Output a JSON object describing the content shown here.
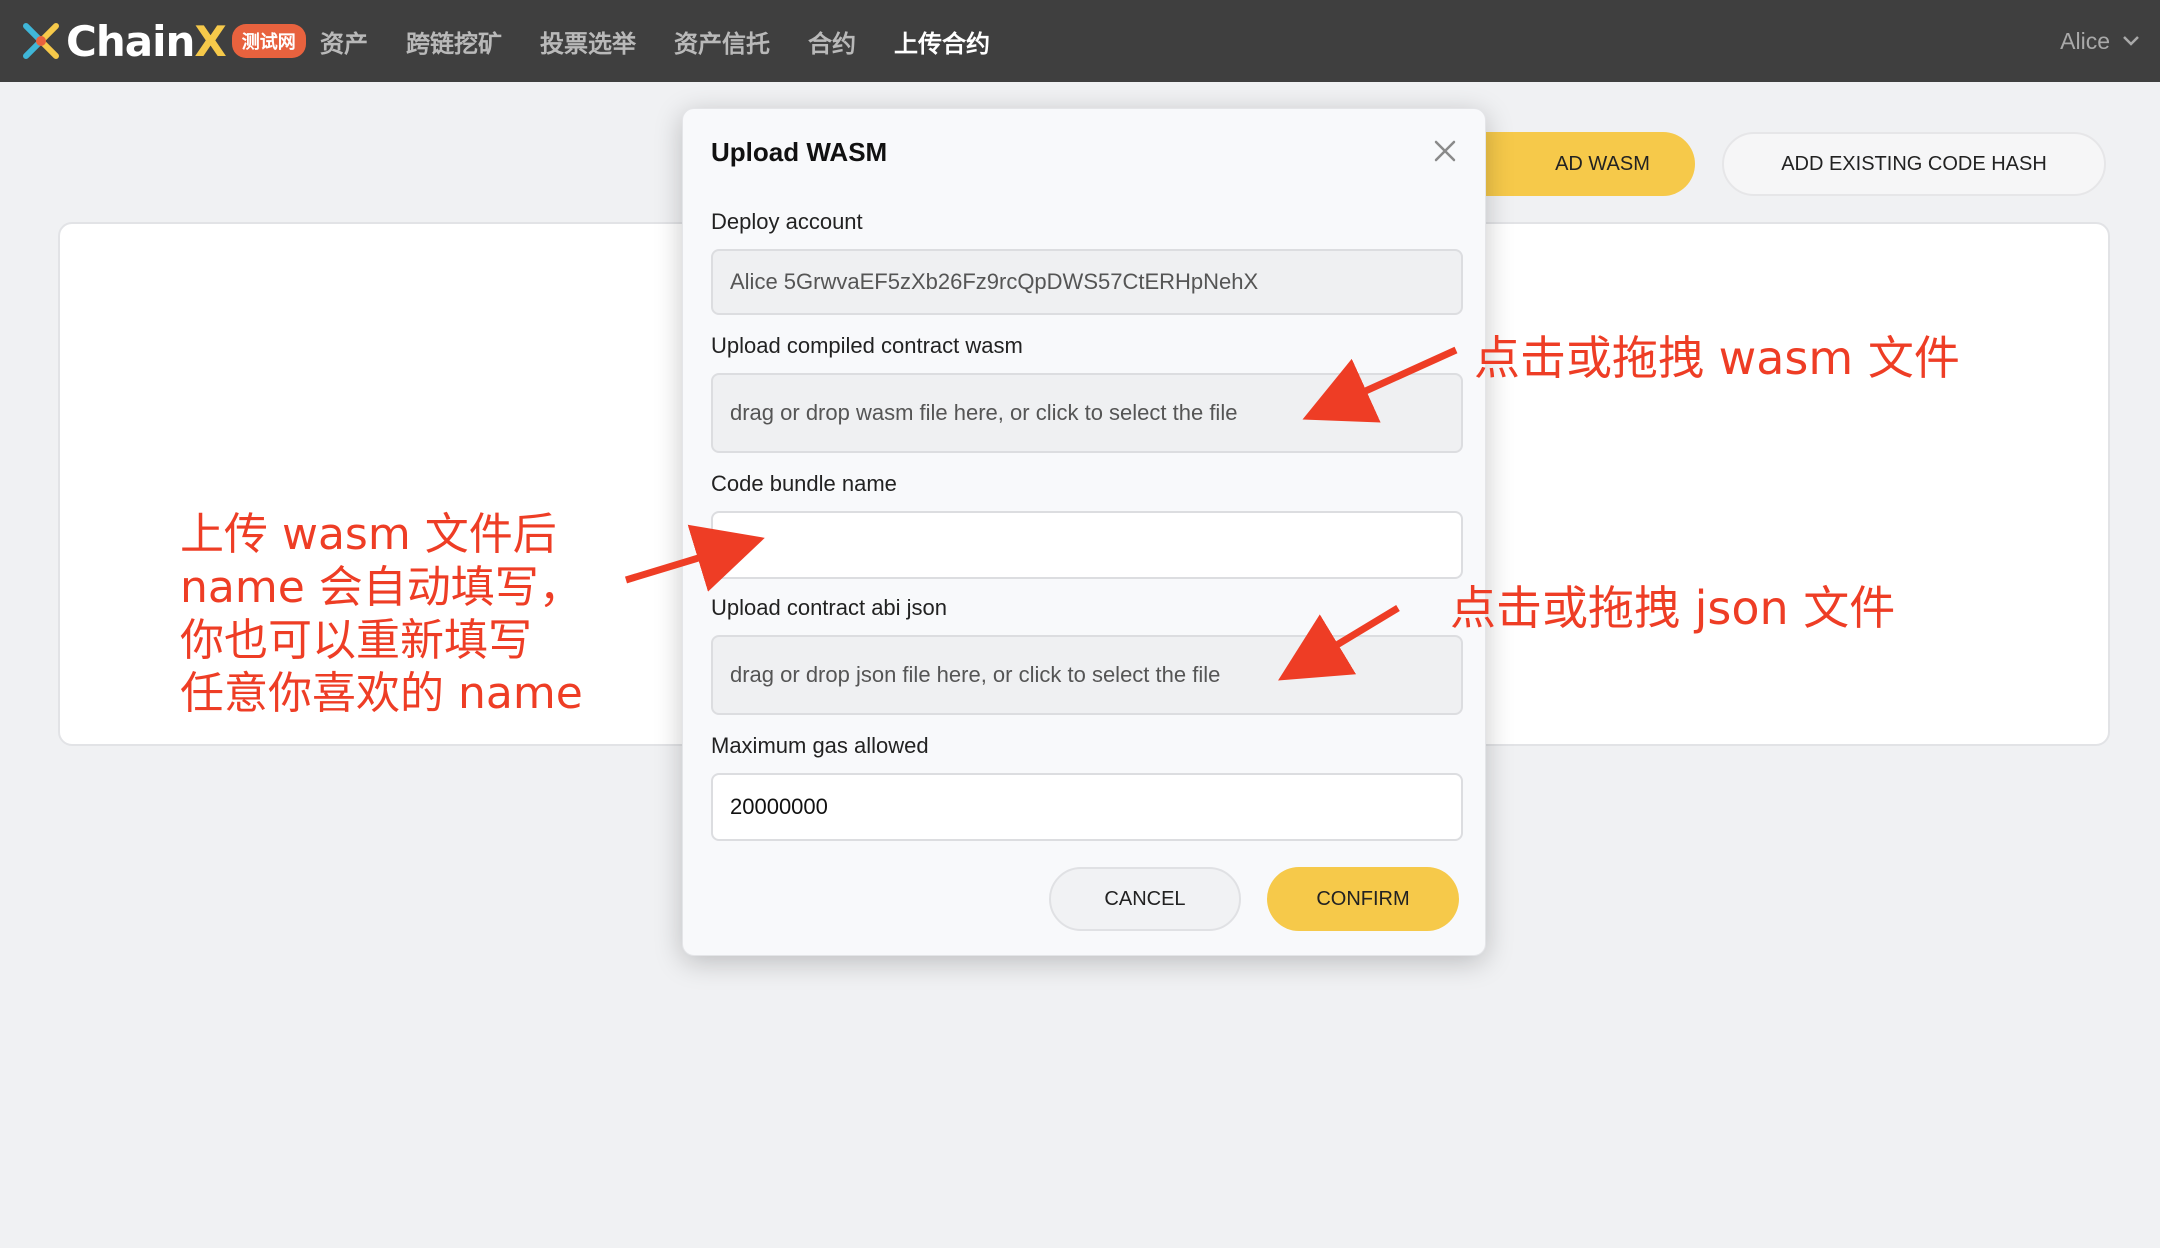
{
  "header": {
    "logo_text": "Chain",
    "logo_x": "X",
    "badge": "测试网",
    "nav": [
      {
        "label": "资产"
      },
      {
        "label": "跨链挖矿"
      },
      {
        "label": "投票选举"
      },
      {
        "label": "资产信托"
      },
      {
        "label": "合约"
      },
      {
        "label": "上传合约"
      }
    ],
    "account_name": "Alice"
  },
  "page": {
    "upload_wasm_button_visible": "AD WASM",
    "add_code_hash_button": "ADD EXISTING CODE HASH"
  },
  "modal": {
    "title": "Upload WASM",
    "deploy_account_label": "Deploy account",
    "deploy_account_value": "Alice 5GrwvaEF5zXb26Fz9rcQpDWS57CtERHpNehX",
    "wasm_label": "Upload compiled contract wasm",
    "wasm_drop_text": "drag or drop wasm file here, or click to select the file",
    "bundle_name_label": "Code bundle name",
    "bundle_name_value": "",
    "abi_label": "Upload contract abi json",
    "abi_drop_text": "drag or drop json file here, or click to select the file",
    "gas_label": "Maximum gas allowed",
    "gas_value": "20000000",
    "cancel_label": "CANCEL",
    "confirm_label": "CONFIRM"
  },
  "annotations": {
    "wasm_hint": "点击或拖拽 wasm 文件",
    "json_hint": "点击或拖拽 json 文件",
    "name_hint_lines": [
      "上传 wasm 文件后",
      "name 会自动填写，",
      "你也可以重新填写",
      "任意你喜欢的 name"
    ]
  },
  "colors": {
    "topbar": "#3f3f3f",
    "accent_yellow": "#f6c94a",
    "badge_orange": "#e8623e",
    "annotation_red": "#ee3d25",
    "page_bg": "#f0f1f3"
  }
}
